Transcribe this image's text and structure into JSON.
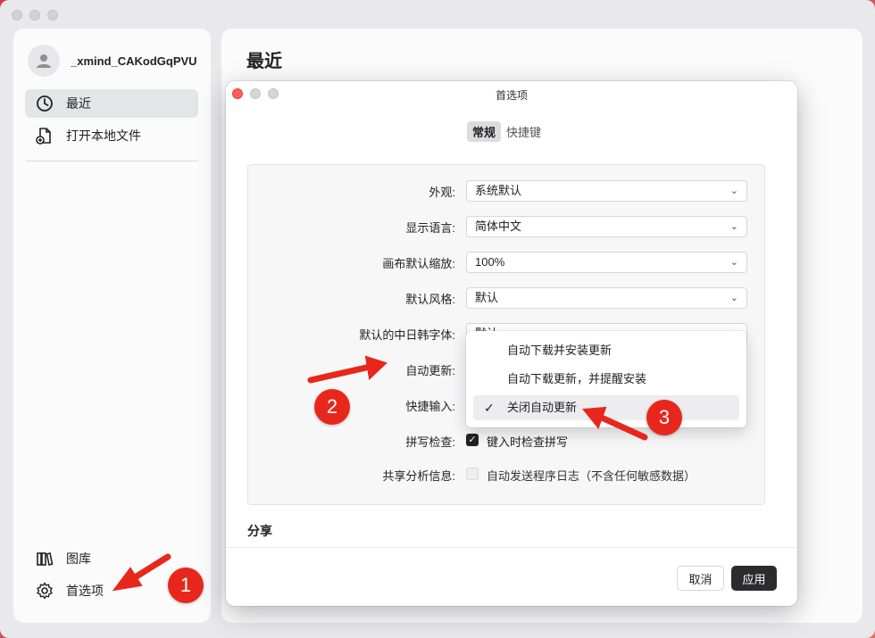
{
  "sidebar": {
    "username": "_xmind_CAKodGqPVU",
    "nav_top": [
      {
        "label": "最近",
        "icon": "clock-icon",
        "active": true
      },
      {
        "label": "打开本地文件",
        "icon": "open-file-icon",
        "active": false
      }
    ],
    "nav_bottom": [
      {
        "label": "图库",
        "icon": "library-icon"
      },
      {
        "label": "首选项",
        "icon": "gear-icon"
      }
    ]
  },
  "main": {
    "title": "最近"
  },
  "dialog": {
    "title": "首选项",
    "tabs": [
      "常规",
      "快捷键"
    ],
    "active_tab": "常规",
    "rows": [
      {
        "label": "外观:",
        "value": "系统默认"
      },
      {
        "label": "显示语言:",
        "value": "简体中文"
      },
      {
        "label": "画布默认缩放:",
        "value": "100%"
      },
      {
        "label": "默认风格:",
        "value": "默认"
      },
      {
        "label": "默认的中日韩字体:",
        "value": "默认"
      },
      {
        "label": "自动更新:",
        "value": ""
      },
      {
        "label": "快捷输入:",
        "value": ""
      }
    ],
    "spellcheck": {
      "label": "拼写检查:",
      "text": "键入时检查拼写",
      "checked": true
    },
    "share": {
      "label": "共享分析信息:",
      "text": "自动发送程序日志（不含任何敏感数据）",
      "checked": false
    },
    "section_share": "分享",
    "cancel_label": "取消",
    "apply_label": "应用"
  },
  "update_menu": {
    "items": [
      {
        "label": "自动下载并安装更新",
        "selected": false
      },
      {
        "label": "自动下载更新，并提醒安装",
        "selected": false
      },
      {
        "label": "关闭自动更新",
        "selected": true
      }
    ],
    "check_glyph": "✓"
  },
  "annotations": {
    "badge_1": "1",
    "badge_2": "2",
    "badge_3": "3",
    "color": "#e8271c"
  },
  "colors": {
    "accent_dark": "#2c2c2e",
    "traffic_red": "#ff5f57",
    "traffic_gray": "#d2d2d5"
  }
}
